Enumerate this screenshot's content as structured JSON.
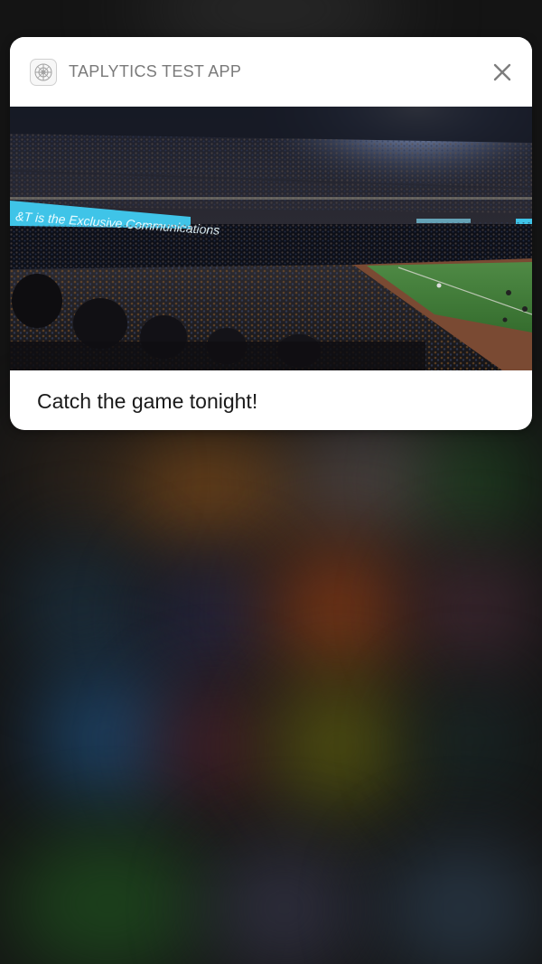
{
  "notification": {
    "app_name": "TAPLYTICS TEST APP",
    "app_icon": "app-grid-icon",
    "close_icon": "close-icon",
    "message": "Catch the game tonight!",
    "image": {
      "subject": "baseball-stadium-photo",
      "banner_text": "&T is the Exclusive Communications"
    }
  },
  "colors": {
    "card_background": "#ffffff",
    "app_name": "#7a7a7a",
    "message_text": "#1a1a1a",
    "field_green": "#3f7a35",
    "banner_cyan": "#3fc4e8"
  }
}
